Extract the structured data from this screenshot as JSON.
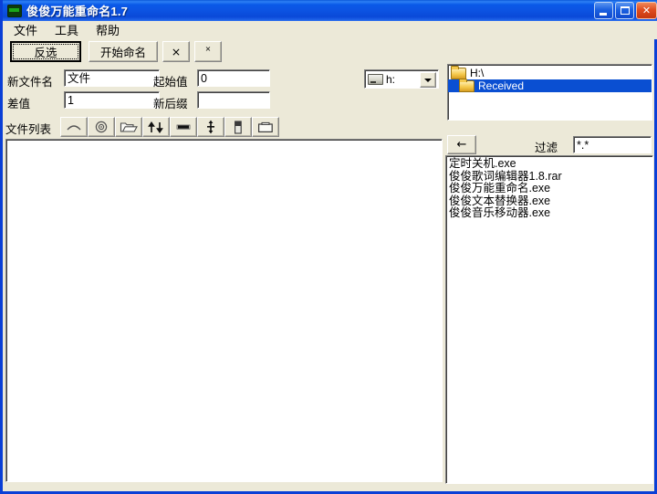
{
  "window": {
    "title": "俊俊万能重命名1.7",
    "app_icon": "app-icon",
    "controls": {
      "minimize": "minimize-button",
      "maximize": "maximize-button",
      "close_label": "✕"
    }
  },
  "menubar": {
    "items": [
      {
        "label": "文件",
        "name": "menu-file"
      },
      {
        "label": "工具",
        "name": "menu-tools"
      },
      {
        "label": "帮助",
        "name": "menu-help"
      }
    ]
  },
  "toolbar": {
    "invert_select": "反选",
    "start_rename": "开始命名",
    "btn_x_large": "×",
    "btn_x_small": "×"
  },
  "fields": {
    "new_name_label": "新文件名",
    "new_name_value": "文件",
    "start_value_label": "起始值",
    "start_value_value": "0",
    "step_label": "差值",
    "step_value": "1",
    "new_suffix_label": "新后缀",
    "new_suffix_value": "",
    "new_suffix_placeholder": ""
  },
  "drive": {
    "selected": "h:",
    "icon": "drive-icon"
  },
  "tree": {
    "items": [
      {
        "label": "H:\\",
        "selected": false,
        "indent": false
      },
      {
        "label": "Received",
        "selected": true,
        "indent": true
      }
    ]
  },
  "file_list_panel": {
    "label": "文件列表",
    "icon_buttons": [
      {
        "name": "arch-up-icon",
        "title": "arch-up"
      },
      {
        "name": "target-circle-icon",
        "title": "target"
      },
      {
        "name": "open-folder-icon",
        "title": "open-folder"
      },
      {
        "name": "up-down-arrows-icon",
        "title": "sort-updown"
      },
      {
        "name": "horizontal-bar-icon",
        "title": "bar"
      },
      {
        "name": "vertical-double-arrow-icon",
        "title": "vertical-arrow"
      },
      {
        "name": "small-box-icon",
        "title": "box"
      },
      {
        "name": "tray-folder-icon",
        "title": "tray"
      }
    ]
  },
  "browser": {
    "back_label": "←",
    "filter_label": "过滤",
    "filter_value": "*.*",
    "files": [
      "定时关机.exe",
      "俊俊歌词编辑器1.8.rar",
      "俊俊万能重命名.exe",
      "俊俊文本替换器.exe",
      "俊俊音乐移动器.exe"
    ]
  },
  "colors": {
    "title_blue": "#0a4fd2",
    "face": "#ece9d8",
    "selection": "#0a4fd2",
    "close_red": "#e04d20"
  }
}
